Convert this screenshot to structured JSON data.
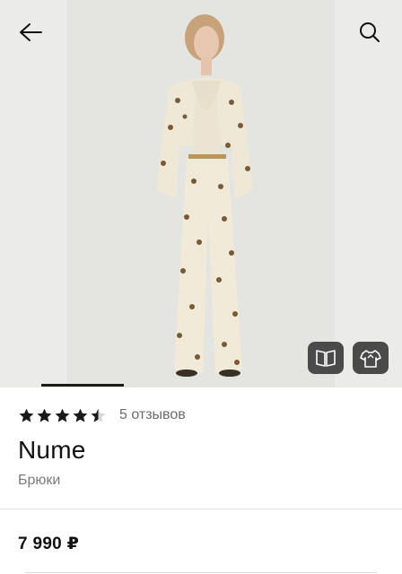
{
  "header": {
    "back_icon": "arrow-left-icon",
    "search_icon": "search-icon"
  },
  "gallery": {
    "image_alt": "Product photo",
    "active_index": 1,
    "actions": [
      {
        "icon": "open-book-icon"
      },
      {
        "icon": "shirt-hanger-icon"
      }
    ]
  },
  "product": {
    "rating": 4.5,
    "reviews_label": "5 отзывов",
    "brand": "Nume",
    "category": "Брюки",
    "price": "7 990 ₽"
  },
  "colors": {
    "star": "#1a1a1a",
    "text_muted": "#6b6b6b",
    "overlay_button": "#4a4a4a"
  }
}
